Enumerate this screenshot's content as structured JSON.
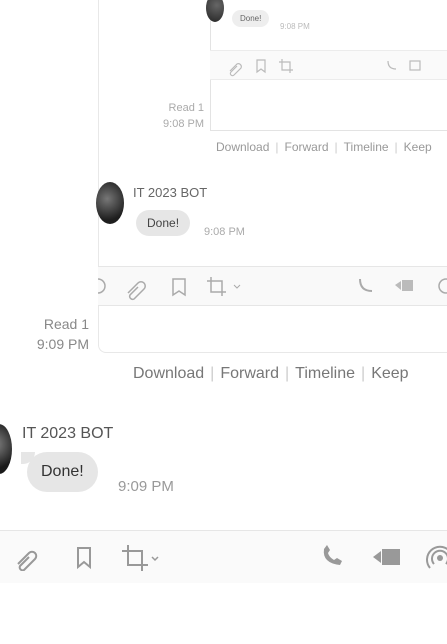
{
  "nested_small": {
    "bubble": "Done!",
    "time": "9:08 PM"
  },
  "nested_middle": {
    "read_count": "Read 1",
    "read_time": "9:08 PM",
    "links": [
      "Download",
      "Forward",
      "Timeline",
      "Keep"
    ],
    "bot_name": "IT 2023 BOT",
    "message": "Done!",
    "time": "9:08 PM"
  },
  "message_actions": {
    "read_count": "Read 1",
    "read_time": "9:09 PM",
    "links": [
      "Download",
      "Forward",
      "Timeline",
      "Keep"
    ]
  },
  "message": {
    "bot_name": "IT 2023 BOT",
    "text": "Done!",
    "time": "9:09 PM"
  },
  "toolbar": {
    "icons": [
      "attach-icon",
      "bookmark-icon",
      "crop-icon",
      "phone-icon",
      "video-icon",
      "broadcast-icon"
    ]
  },
  "colors": {
    "bubble": "#e6e6e6",
    "link": "#777777",
    "toolbar_bg": "#fafafa"
  }
}
